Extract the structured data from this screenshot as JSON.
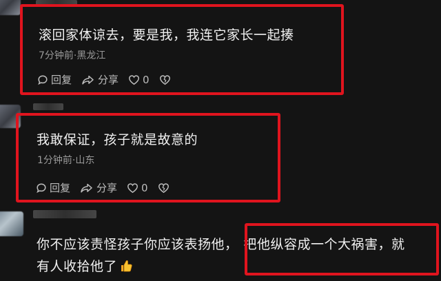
{
  "comments": [
    {
      "text": "滚回家体谅去，要是我，我连它家长一起揍",
      "time": "7分钟前",
      "location": "黑龙江",
      "meta": "7分钟前·黑龙江",
      "reply_label": "回复",
      "share_label": "分享",
      "like_count": "0"
    },
    {
      "text": "我敢保证，孩子就是故意的",
      "time": "1分钟前",
      "location": "山东",
      "meta": "1分钟前·山东",
      "reply_label": "回复",
      "share_label": "分享",
      "like_count": "0"
    },
    {
      "text_line1_part1": "你不应该责怪孩子你应该表扬他，",
      "text_line1_part2": "把他纵容成一个大祸害，就",
      "text_line2": "有人收拾他了"
    }
  ],
  "colors": {
    "background": "#141414",
    "highlight_box": "#e0141e",
    "text": "#f0f0f0",
    "meta": "#9a9a9a"
  },
  "icons": [
    "comment-icon",
    "share-icon",
    "heart-icon",
    "broken-heart-icon",
    "thumbs-up-emoji"
  ]
}
